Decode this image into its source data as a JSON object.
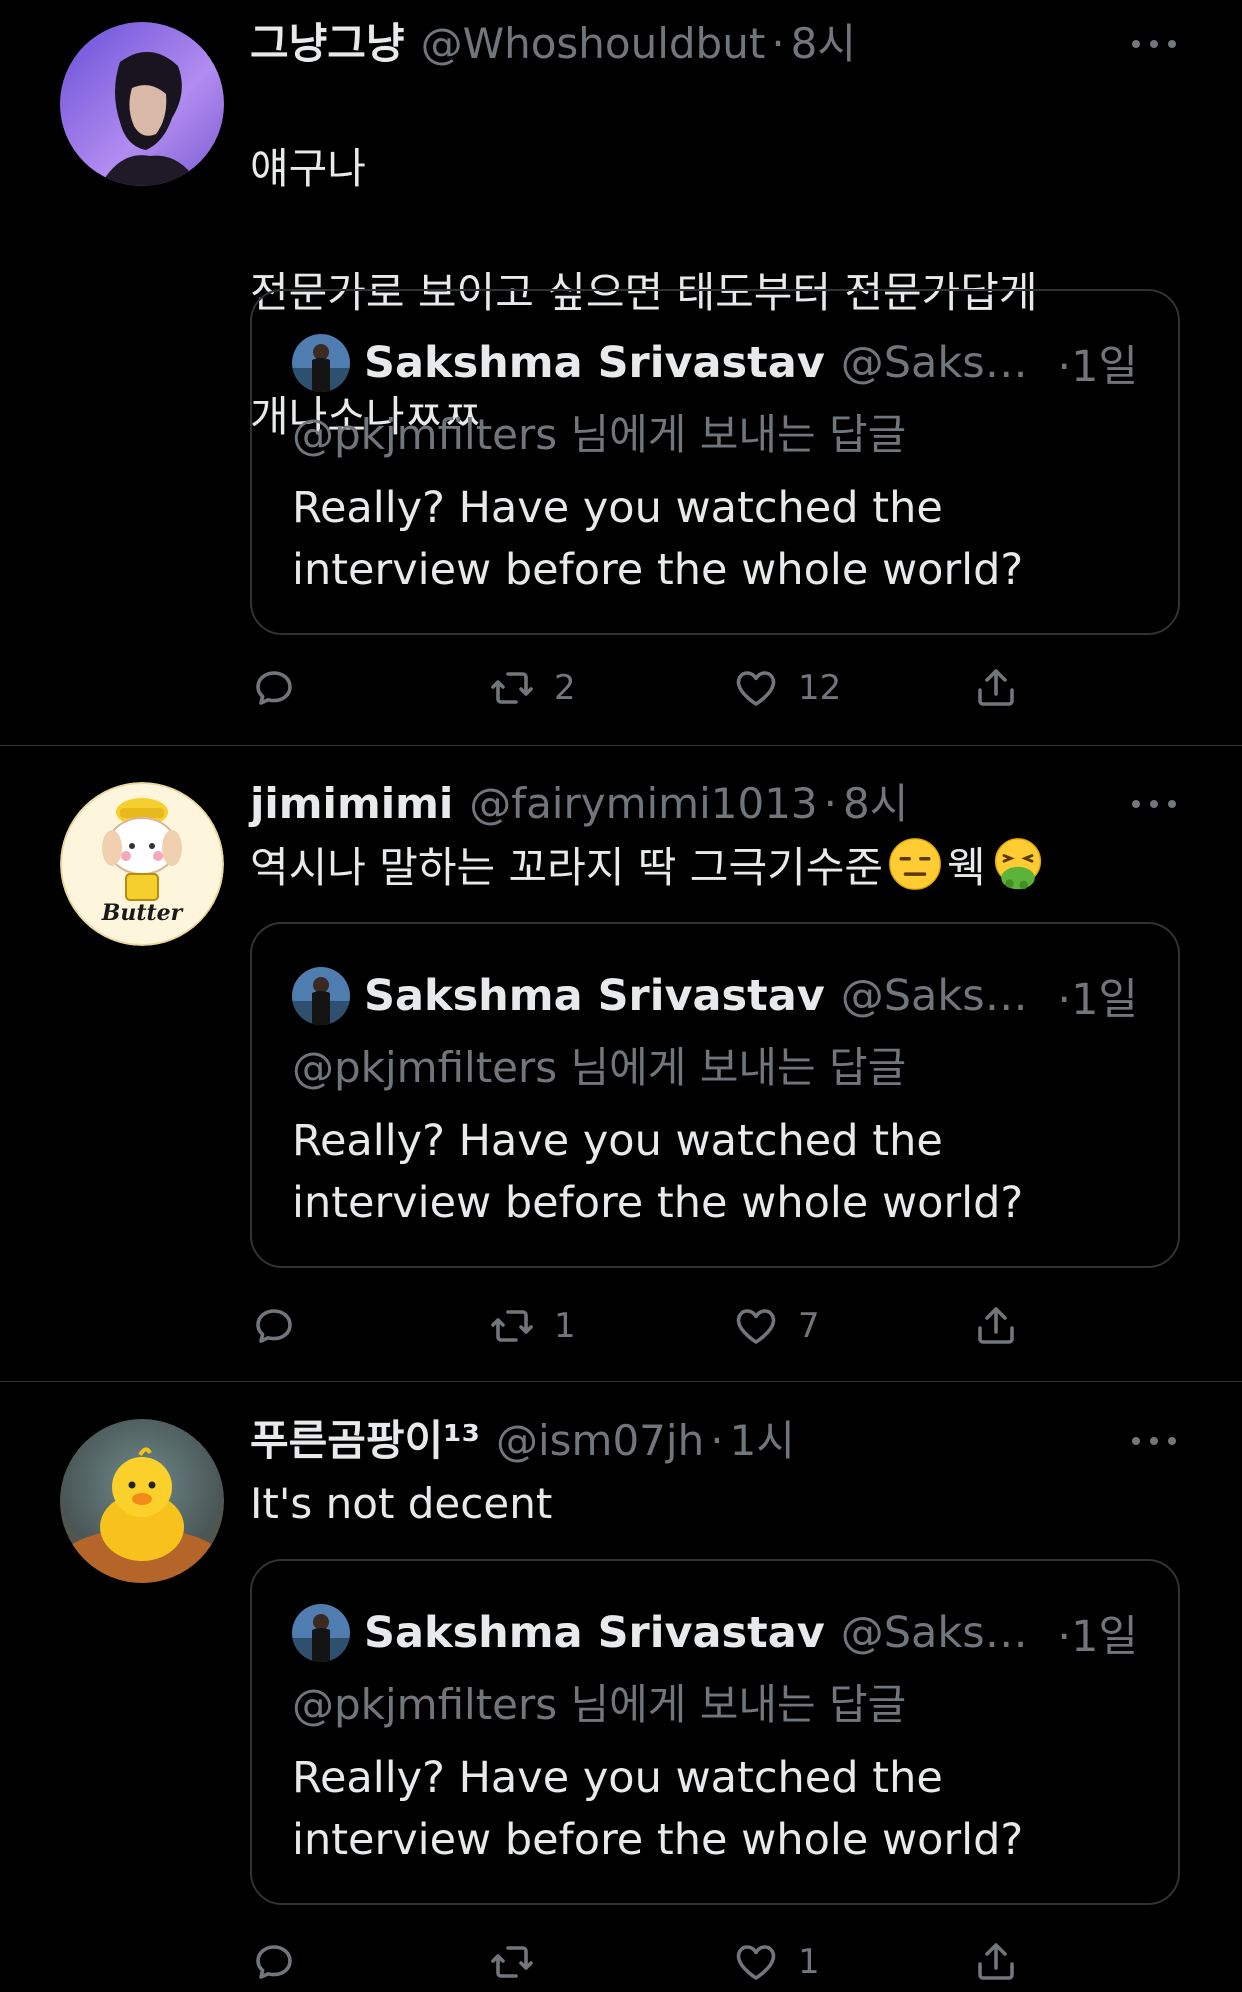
{
  "tweets": [
    {
      "name": "그냥그냥",
      "handle": "@Whoshouldbut",
      "dot": "·",
      "time": "8시",
      "text_lines": [
        "얘구나",
        "전문가로 보이고 싶으면 태도부터 전문가답게",
        "개나소나ㅉㅉ"
      ],
      "avatar_icon": "person-photo-avatar",
      "quote": {
        "name": "Sakshma Srivastav",
        "handle": "@Saksh...",
        "time": "·1일",
        "replying": "@pkjmfilters 님에게 보내는 답글",
        "text": "Really? Have you watched the interview before the whole world?"
      },
      "retweets": "2",
      "likes": "12"
    },
    {
      "name": "jimimimi",
      "handle": "@fairymimi1013",
      "dot": "·",
      "time": "8시",
      "text": "역시나 말하는 꼬라지 딱 그극기수준",
      "text_after": "웩",
      "emoji_1": "expressionless-face-emoji",
      "emoji_2": "vomiting-face-emoji",
      "avatar_icon": "butter-character-avatar",
      "avatar_label": "Butter",
      "quote": {
        "name": "Sakshma Srivastav",
        "handle": "@Saksh...",
        "time": "·1일",
        "replying": "@pkjmfilters 님에게 보내는 답글",
        "text": "Really? Have you watched the interview before the whole world?"
      },
      "retweets": "1",
      "likes": "7"
    },
    {
      "name": "푸른곰팡이¹³",
      "handle": "@ism07jh",
      "dot": "·",
      "time": "1시",
      "text": "It's not decent",
      "avatar_icon": "duck-avatar",
      "quote": {
        "name": "Sakshma Srivastav",
        "handle": "@Saksh...",
        "time": "·1일",
        "replying": "@pkjmfilters 님에게 보내는 답글",
        "text": "Really? Have you watched the interview before the whole world?"
      },
      "retweets": "",
      "likes": "1"
    }
  ],
  "colors": {
    "background": "#000000",
    "text_primary": "#e7e9ea",
    "text_secondary": "#71767b",
    "border": "#2f3336"
  },
  "icons": [
    "reply-icon",
    "retweet-icon",
    "like-icon",
    "share-icon",
    "more-icon"
  ]
}
